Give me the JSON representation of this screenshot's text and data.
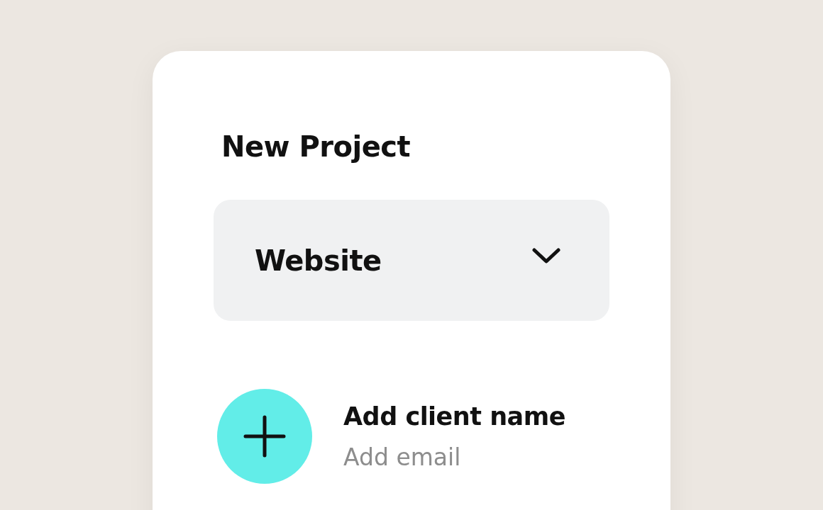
{
  "card": {
    "title": "New Project"
  },
  "dropdown": {
    "value": "Website"
  },
  "client": {
    "name": "Add client name",
    "email": "Add email"
  }
}
